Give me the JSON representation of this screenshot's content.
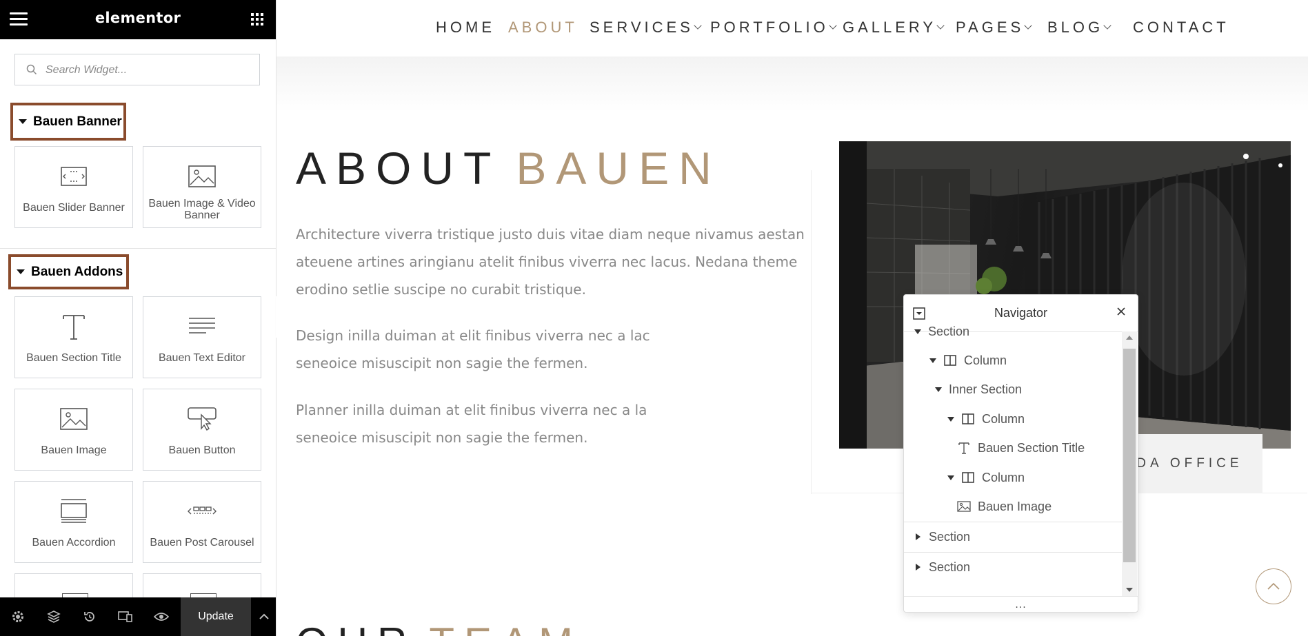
{
  "sidebar": {
    "logo": "elementor",
    "search_placeholder": "Search Widget...",
    "categories": [
      {
        "label": "Bauen Banner"
      },
      {
        "label": "Bauen Addons"
      }
    ],
    "banner_widgets": [
      {
        "label": "Bauen Slider Banner",
        "icon": "slider-icon"
      },
      {
        "label": "Bauen Image & Video Banner",
        "icon": "image-icon"
      }
    ],
    "addon_widgets": [
      {
        "label": "Bauen Section Title",
        "icon": "title-text-icon"
      },
      {
        "label": "Bauen Text Editor",
        "icon": "text-editor-icon"
      },
      {
        "label": "Bauen Image",
        "icon": "image-icon"
      },
      {
        "label": "Bauen Button",
        "icon": "button-cursor-icon"
      },
      {
        "label": "Bauen Accordion",
        "icon": "accordion-icon"
      },
      {
        "label": "Bauen Post Carousel",
        "icon": "carousel-icon"
      }
    ],
    "footer": {
      "update_label": "Update"
    }
  },
  "site": {
    "nav": [
      {
        "label": "HOME",
        "active": false,
        "dropdown": false
      },
      {
        "label": "ABOUT",
        "active": true,
        "dropdown": false
      },
      {
        "label": "SERVICES",
        "active": false,
        "dropdown": true
      },
      {
        "label": "PORTFOLIO",
        "active": false,
        "dropdown": true
      },
      {
        "label": "GALLERY",
        "active": false,
        "dropdown": true
      },
      {
        "label": "PAGES",
        "active": false,
        "dropdown": true
      },
      {
        "label": "BLOG",
        "active": false,
        "dropdown": true
      },
      {
        "label": "CONTACT",
        "active": false,
        "dropdown": false
      }
    ],
    "about": {
      "title_main": "ABOUT",
      "title_accent": "BAUEN",
      "paragraphs": [
        [
          "Architecture viverra tristique justo duis vitae diam neque nivamus aestan",
          "ateuene artines aringianu atelit finibus viverra nec lacus.  Nedana theme",
          "erodino setlie suscipe no curabit tristique."
        ],
        [
          "Design inilla duiman at elit finibus viverra nec a lac",
          "seneoice misuscipit non sagie the fermen."
        ],
        [
          "Planner inilla duiman at elit finibus viverra nec a la",
          "seneoice misuscipit non sagie the fermen."
        ]
      ],
      "office_label": "CANADA OFFICE"
    },
    "team": {
      "title_main": "OUR",
      "title_accent": "TEAM"
    }
  },
  "navigator": {
    "title": "Navigator",
    "rows": [
      {
        "label": "Section",
        "level": 0,
        "expanded": true,
        "icon": ""
      },
      {
        "label": "Column",
        "level": 1,
        "expanded": true,
        "icon": "column-icon"
      },
      {
        "label": "Inner Section",
        "level": 2,
        "expanded": true,
        "icon": ""
      },
      {
        "label": "Column",
        "level": 3,
        "expanded": true,
        "icon": "column-icon"
      },
      {
        "label": "Bauen Section Title",
        "level": 4,
        "expanded": null,
        "icon": "title-text-icon"
      },
      {
        "label": "Column",
        "level": 3,
        "expanded": true,
        "icon": "column-icon"
      },
      {
        "label": "Bauen Image",
        "level": 4,
        "expanded": null,
        "icon": "image-icon"
      },
      {
        "label": "Section",
        "level": 0,
        "expanded": false,
        "icon": ""
      },
      {
        "label": "Section",
        "level": 0,
        "expanded": false,
        "icon": ""
      }
    ],
    "footer": "..."
  },
  "colors": {
    "accent": "#b19777",
    "category_border": "#8a4b2c",
    "sidebar_header": "#000000",
    "update_button": "#333333"
  }
}
